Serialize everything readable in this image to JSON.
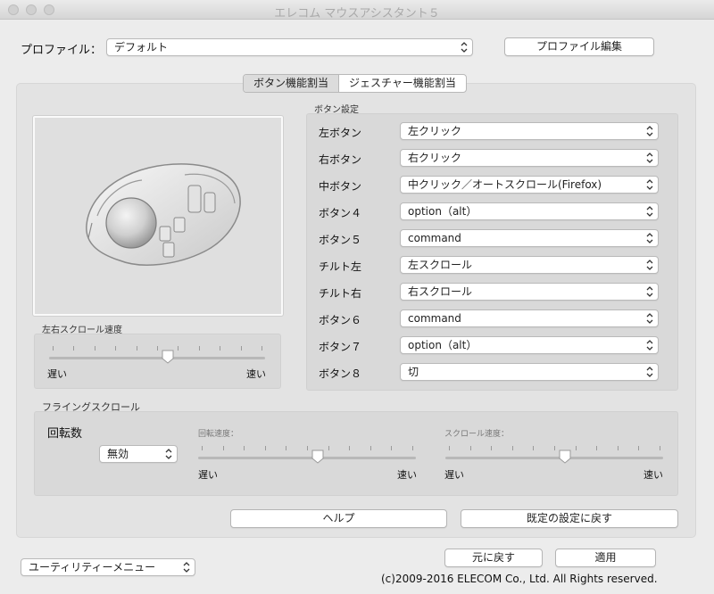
{
  "window": {
    "title": "エレコム マウスアシスタント５"
  },
  "profile": {
    "label": "プロファイル：",
    "value": "デフォルト",
    "edit_button": "プロファイル編集"
  },
  "tabs": [
    {
      "label": "ボタン機能割当",
      "selected": true
    },
    {
      "label": "ジェスチャー機能割当",
      "selected": false
    }
  ],
  "button_settings": {
    "title": "ボタン設定",
    "rows": [
      {
        "label": "左ボタン",
        "value": "左クリック"
      },
      {
        "label": "右ボタン",
        "value": "右クリック"
      },
      {
        "label": "中ボタン",
        "value": "中クリック／オートスクロール(Firefox)"
      },
      {
        "label": "ボタン４",
        "value": "option（alt）"
      },
      {
        "label": "ボタン５",
        "value": "command"
      },
      {
        "label": "チルト左",
        "value": "左スクロール"
      },
      {
        "label": "チルト右",
        "value": "右スクロール"
      },
      {
        "label": "ボタン６",
        "value": "command"
      },
      {
        "label": "ボタン７",
        "value": "option（alt）"
      },
      {
        "label": "ボタン８",
        "value": "切"
      }
    ]
  },
  "horizontal_scroll": {
    "title": "左右スクロール速度",
    "slow": "遅い",
    "fast": "速い",
    "level": 0.55
  },
  "flying_scroll": {
    "title": "フライングスクロール",
    "rotation_label": "回転数",
    "rotation_value": "無効",
    "rotation_speed": {
      "title": "回転速度：",
      "slow": "遅い",
      "fast": "速い",
      "level": 0.55
    },
    "scroll_speed": {
      "title": "スクロール速度：",
      "slow": "遅い",
      "fast": "速い",
      "level": 0.55
    }
  },
  "buttons": {
    "help": "ヘルプ",
    "reset_default": "既定の設定に戻す",
    "revert": "元に戻す",
    "apply": "適用"
  },
  "utility_menu": "ユーティリティーメニュー",
  "copyright": "(c)2009-2016 ELECOM Co., Ltd. All Rights reserved."
}
